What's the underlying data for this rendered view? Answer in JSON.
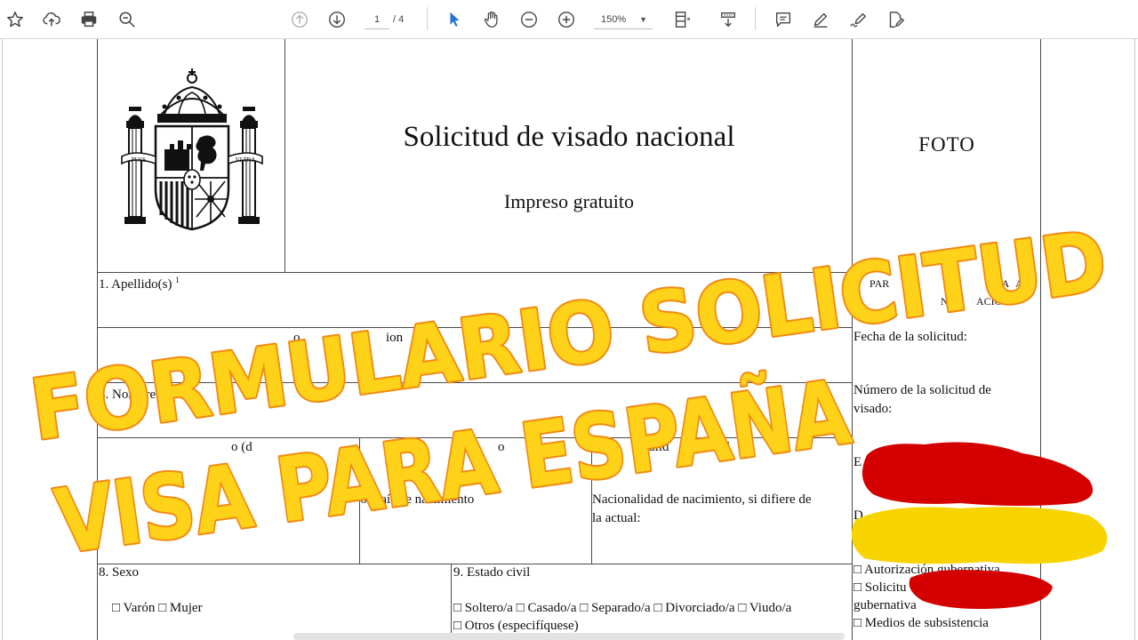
{
  "toolbar": {
    "bookmark_icon": "star-icon",
    "upload_icon": "cloud-upload-icon",
    "print_icon": "printer-icon",
    "search_icon": "zoom-search-icon",
    "prev_page_icon": "arrow-up-circle-icon",
    "next_page_icon": "arrow-down-circle-icon",
    "current_page": "1",
    "total_pages": "/ 4",
    "select_tool_icon": "cursor-icon",
    "hand_tool_icon": "hand-icon",
    "zoom_out_icon": "minus-circle-icon",
    "zoom_in_icon": "plus-circle-icon",
    "zoom_level": "150%",
    "fit_icon": "page-fit-icon",
    "scroll_mode_icon": "scroll-mode-icon",
    "comment_icon": "comment-icon",
    "highlight_icon": "pen-icon",
    "sign_icon": "signature-pen-icon",
    "fill_sign_icon": "edit-document-icon",
    "accent_color": "#2b73d6"
  },
  "form": {
    "title": "Solicitud de visado nacional",
    "subtitle": "Impreso gratuito",
    "photo_label": "FOTO",
    "field1": "1. Apellido(s)",
    "field1_sup": "1",
    "field2_partial": "o",
    "field2_partial2": "ion",
    "field3": "3. Nombre(s)",
    "field3_sup": "3",
    "field4_partial": "o (d",
    "field4_partial2": "o",
    "field5_partial": "alid",
    "field5_partial2": "ctual",
    "field6": "6. País de nacimiento",
    "field7_line1": "Nacionalidad de nacimiento, si difiere de",
    "field7_line2": "la actual:",
    "field8": "8. Sexo",
    "sexo_options": "□ Varón □ Mujer",
    "field9": "9. Estado civil",
    "estado_options": "□ Soltero/a □ Casado/a □ Separado/a □ Divorciado/a □ Viudo/a",
    "estado_otros": "□ Otros (especifíquese)",
    "side_header_partial1": "PAR",
    "side_header_partial2": "ES",
    "side_header_partial3": "DA",
    "side_header_partial4": "A",
    "side_header_partial5": "NI",
    "side_header_partial6": "ACIÓ",
    "fecha_solicitud": "Fecha de la solicitud:",
    "numero_solicitud_line1": "Número de la solicitud de",
    "numero_solicitud_line2": "visado:",
    "side_partial_e": "E",
    "side_partial_d": "D",
    "autorizacion": "□ Autorización gubernativa",
    "solicitud_partial": "□ Solicitu",
    "gubernativa": "gubernativa",
    "medios": "□ Medios de subsistencia"
  },
  "overlay": {
    "line1": "FORMULARIO SOLICITUD",
    "line2": "VISA PARA ESPAÑA",
    "text_color": "#ffd21a",
    "outline_color": "#f08a12",
    "flag_red": "#d40000",
    "flag_yellow": "#f7d400"
  }
}
